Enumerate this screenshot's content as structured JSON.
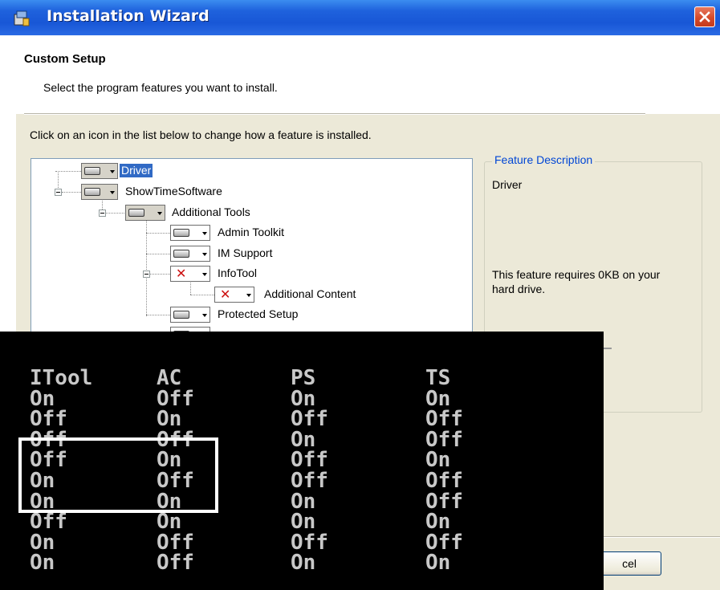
{
  "window": {
    "title": "Installation Wizard",
    "close_icon": "close-icon",
    "app_icon": "installer-icon"
  },
  "header": {
    "title": "Custom Setup",
    "subtitle": "Select the program features you want to install."
  },
  "instruction": "Click on an icon in the list below to change how a feature is installed.",
  "tree": {
    "items": [
      {
        "label": "Driver",
        "state": "installed",
        "selected": true
      },
      {
        "label": "ShowTimeSoftware",
        "state": "installed"
      },
      {
        "label": "Additional Tools",
        "state": "installed"
      },
      {
        "label": "Admin Toolkit",
        "state": "installed"
      },
      {
        "label": "IM Support",
        "state": "installed"
      },
      {
        "label": "InfoTool",
        "state": "not-installed"
      },
      {
        "label": "Additional Content",
        "state": "not-installed"
      },
      {
        "label": "Protected Setup",
        "state": "installed"
      }
    ]
  },
  "feature_description": {
    "legend": "Feature Description",
    "text": "Driver",
    "requirement": "This feature requires 0KB on your hard drive."
  },
  "buttons": {
    "cancel_partial": "cel"
  },
  "console": {
    "headers": [
      "ITool",
      "AC",
      "PS",
      "TS"
    ],
    "rows": [
      [
        "On",
        "Off",
        "On",
        "On"
      ],
      [
        "Off",
        "On",
        "Off",
        "Off"
      ],
      [
        "Off",
        "Off",
        "On",
        "Off"
      ],
      [
        "Off",
        "On",
        "Off",
        "On"
      ],
      [
        "On",
        "Off",
        "Off",
        "Off"
      ],
      [
        "On",
        "On",
        "On",
        "Off"
      ],
      [
        "Off",
        "On",
        "On",
        "On"
      ],
      [
        "On",
        "Off",
        "Off",
        "Off"
      ]
    ],
    "highlighted_rows": [
      2,
      3,
      4
    ],
    "highlighted_columns": [
      0,
      1
    ]
  },
  "colors": {
    "title_bar": "#1f62dd",
    "window_bg": "#ece9d8",
    "selection": "#316ac5",
    "legend": "#0046d5",
    "not_installed": "#cc1111",
    "console_bg": "#000000",
    "console_text": "#c8c8c8"
  }
}
